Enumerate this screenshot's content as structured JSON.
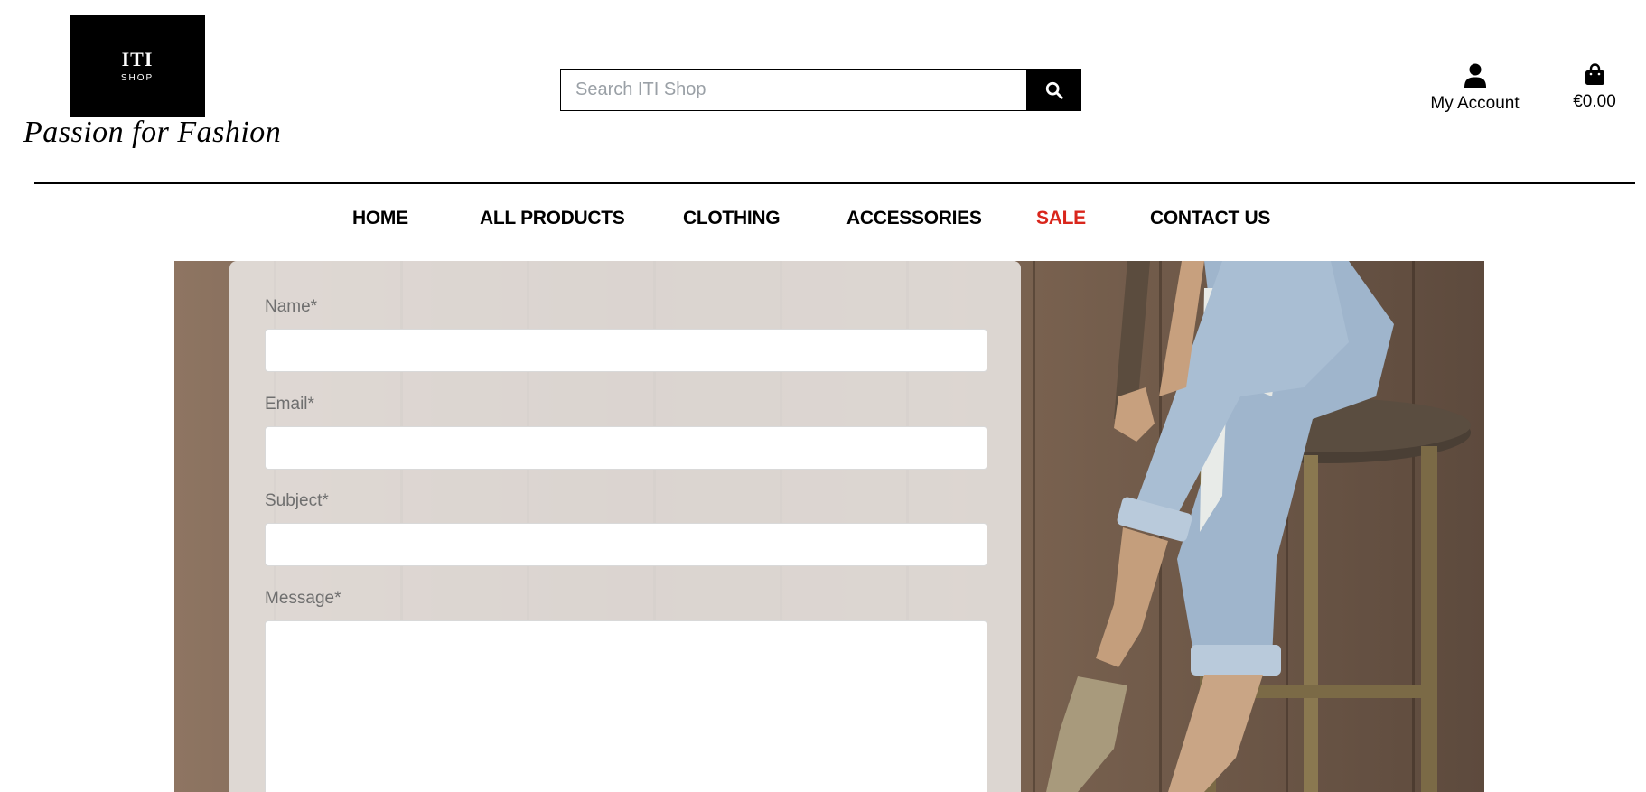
{
  "brand": {
    "logo_title": "ITI",
    "logo_subtitle": "SHOP",
    "tagline": "Passion for Fashion"
  },
  "search": {
    "placeholder": "Search ITI Shop",
    "button_icon": "search-icon"
  },
  "account": {
    "icon": "user-icon",
    "label": "My Account"
  },
  "bag": {
    "icon": "shopping-bag-icon",
    "total": "€0.00"
  },
  "nav": {
    "items": [
      {
        "label": "HOME"
      },
      {
        "label": "ALL PRODUCTS"
      },
      {
        "label": "CLOTHING"
      },
      {
        "label": "ACCESSORIES"
      },
      {
        "label": "SALE",
        "color": "#d9261c"
      },
      {
        "label": "CONTACT US"
      }
    ]
  },
  "contact_form": {
    "name_label": "Name*",
    "email_label": "Email*",
    "subject_label": "Subject*",
    "message_label": "Message*",
    "name_value": "",
    "email_value": "",
    "subject_value": "",
    "message_value": ""
  },
  "colors": {
    "accent": "#000000",
    "sale": "#d9261c",
    "label_gray": "#6f6f6f"
  }
}
